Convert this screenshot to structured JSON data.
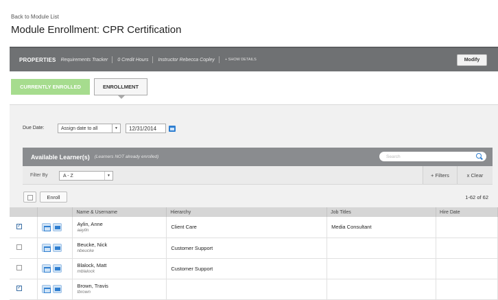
{
  "header": {
    "back_link": "Back to Module List",
    "title": "Module Enrollment: CPR Certification"
  },
  "properties": {
    "label": "PROPERTIES",
    "items": [
      "Requirements Tracker",
      "0 Credit Hours",
      "Instructor Rebecca Copley"
    ],
    "show_details": "+ SHOW DETAILS",
    "modify_label": "Modify"
  },
  "tabs": {
    "current": "CURRENTLY ENROLLED",
    "enrollment": "ENROLLMENT"
  },
  "due_date": {
    "label": "Due Date:",
    "assign_option": "Assign date to all",
    "date_value": "12/31/2014"
  },
  "learners": {
    "title": "Available Learner(s)",
    "subtitle": "(Learners NOT already enrolled)",
    "search_placeholder": "Search",
    "filter_label": "Filter By",
    "filter_value": "A - Z",
    "filters_label": "+ Filters",
    "clear_label": "x Clear",
    "enroll_label": "Enroll",
    "count": "1-62 of 62",
    "columns": [
      "",
      "",
      "Name & Username",
      "Hierarchy",
      "Job Titles",
      "Hire Date"
    ],
    "rows": [
      {
        "checked": true,
        "name": "Aylin, Anne",
        "username": "aaylin",
        "hierarchy": "Client Care",
        "job_title": "Media Consultant",
        "hire_date": ""
      },
      {
        "checked": false,
        "name": "Beucke, Nick",
        "username": "nbeucke",
        "hierarchy": "Customer Support",
        "job_title": "",
        "hire_date": ""
      },
      {
        "checked": false,
        "name": "Blalock, Matt",
        "username": "mblalock",
        "hierarchy": "Customer Support",
        "job_title": "",
        "hire_date": ""
      },
      {
        "checked": true,
        "name": "Brown, Travis",
        "username": "tbrown",
        "hierarchy": "",
        "job_title": "",
        "hire_date": ""
      }
    ]
  },
  "colors": {
    "accent": "#2f7fd1",
    "enrolled_tab": "#a6dc8e",
    "properties_bar": "#6f7173",
    "learners_bar": "#8a8c8f"
  }
}
